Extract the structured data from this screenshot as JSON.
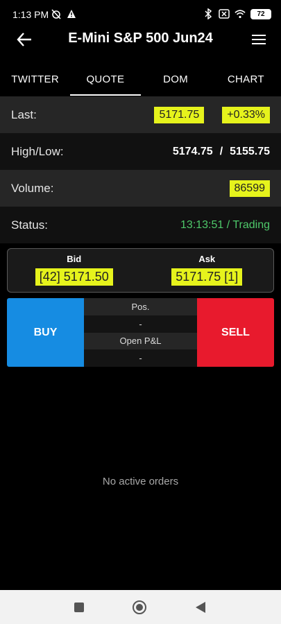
{
  "status_bar": {
    "time": "1:13 PM",
    "battery": "72",
    "icons": [
      "alarm-off-icon",
      "warning-icon",
      "bluetooth-icon",
      "no-sim-icon",
      "wifi-icon",
      "battery-icon"
    ]
  },
  "app_bar": {
    "title": "E-Mini S&P 500 Jun24",
    "back_icon": "arrow-left-icon",
    "menu_icon": "hamburger-menu-icon"
  },
  "tabs": [
    {
      "label": "TWITTER",
      "active": false
    },
    {
      "label": "QUOTE",
      "active": true
    },
    {
      "label": "DOM",
      "active": false
    },
    {
      "label": "CHART",
      "active": false
    }
  ],
  "quote": {
    "last_label": "Last:",
    "last_value": "5171.75",
    "last_change": "+0.33%",
    "highlow_label": "High/Low:",
    "high": "5174.75",
    "separator": "/",
    "low": "5155.75",
    "volume_label": "Volume:",
    "volume": "86599",
    "status_label": "Status:",
    "status_value": "13:13:51 / Trading"
  },
  "bid_ask": {
    "bid_label": "Bid",
    "bid_value": "[42] 5171.50",
    "ask_label": "Ask",
    "ask_value": "5171.75 [1]"
  },
  "trade": {
    "buy_label": "BUY",
    "sell_label": "SELL",
    "pos_label": "Pos.",
    "pos_value": "-",
    "pnl_label": "Open P&L",
    "pnl_value": "-"
  },
  "orders": {
    "empty_text": "No active orders"
  },
  "colors": {
    "highlight": "#e6f31c",
    "buy": "#168ce2",
    "sell": "#e81a2d",
    "status_green": "#4ec96a"
  }
}
